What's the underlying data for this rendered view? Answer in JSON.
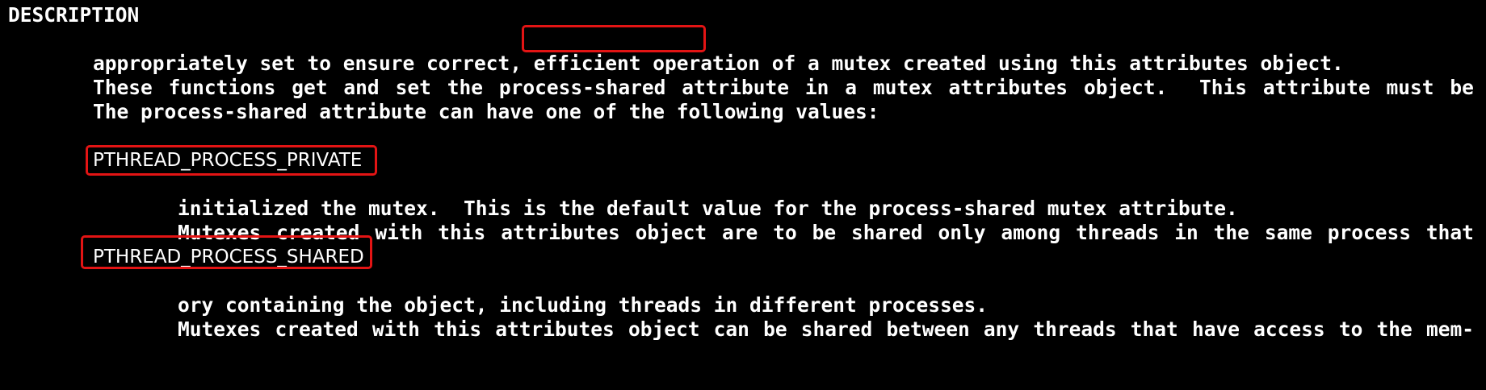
{
  "section_heading": "DESCRIPTION",
  "para1": {
    "line1_words": [
      "These",
      "functions",
      "get",
      "and",
      "set",
      "the"
    ],
    "highlight_term": "process-shared",
    "line1_rest_words": [
      "attribute",
      "in",
      "a",
      "mutex",
      "attributes",
      "object.",
      "",
      "This",
      "attribute",
      "must",
      "be"
    ],
    "line2": "appropriately set to ensure correct, efficient operation of a mutex created using this attributes object."
  },
  "para2": "The process-shared attribute can have one of the following values:",
  "values": [
    {
      "name": "PTHREAD_PROCESS_PRIVATE",
      "line1_words": [
        "Mutexes",
        "created",
        "with",
        "this",
        "attributes",
        "object",
        "are",
        "to",
        "be",
        "shared",
        "only",
        "among",
        "threads",
        "in",
        "the",
        "same",
        "process",
        "that"
      ],
      "line2": "initialized the mutex.  This is the default value for the process-shared mutex attribute."
    },
    {
      "name": "PTHREAD_PROCESS_SHARED",
      "line1_words": [
        "Mutexes",
        "created",
        "with",
        "this",
        "attributes",
        "object",
        "can",
        "be",
        "shared",
        "between",
        "any",
        "threads",
        "that",
        "have",
        "access",
        "to",
        "the",
        "mem-"
      ],
      "line2": "ory containing the object, including threads in different processes."
    }
  ],
  "highlight_color": "#e31414",
  "text_color": "#ffffff",
  "background_color": "#000000"
}
